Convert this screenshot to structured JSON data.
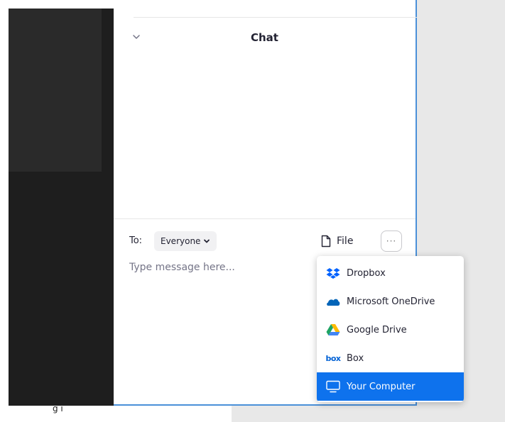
{
  "background_fragment": "g ı",
  "chat": {
    "title": "Chat",
    "to_label": "To:",
    "recipient": "Everyone",
    "file_label": "File",
    "more_label": "···",
    "message_placeholder": "Type message here..."
  },
  "share_menu": {
    "items": [
      {
        "label": "Dropbox",
        "icon": "dropbox-icon",
        "color": "#0061fe"
      },
      {
        "label": "Microsoft OneDrive",
        "icon": "onedrive-icon",
        "color": "#0364b8"
      },
      {
        "label": "Google Drive",
        "icon": "google-drive-icon",
        "color": "#1fa463"
      },
      {
        "label": "Box",
        "icon": "box-icon",
        "color": "#0061d5",
        "logo_text": "box"
      },
      {
        "label": "Your Computer",
        "icon": "monitor-icon",
        "color": "#ffffff"
      }
    ],
    "selected_index": 4
  },
  "colors": {
    "accent": "#0e72ed",
    "panel_border": "#4a90d9",
    "video_bg": "#1e1e1e"
  }
}
